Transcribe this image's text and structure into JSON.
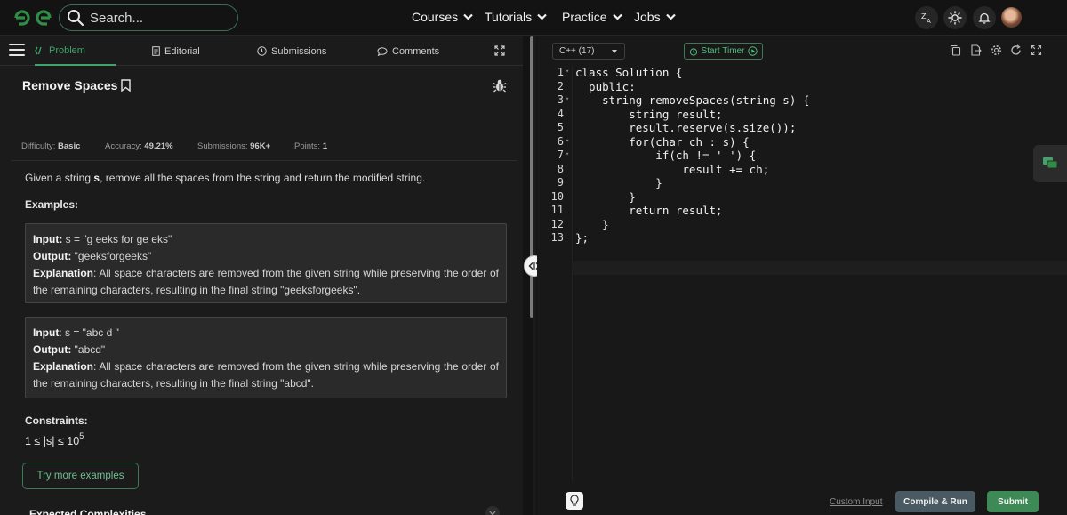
{
  "navbar": {
    "search_placeholder": "Search...",
    "menu": [
      "Courses",
      "Tutorials",
      "Practice",
      "Jobs"
    ],
    "colors": {
      "brand": "#2f8d46",
      "search_border": "#3b6d52"
    }
  },
  "tabs": {
    "problem": "Problem",
    "editorial": "Editorial",
    "submissions": "Submissions",
    "comments": "Comments"
  },
  "problem": {
    "title": "Remove Spaces",
    "difficulty_label": "Difficulty:",
    "difficulty": "Basic",
    "accuracy_label": "Accuracy:",
    "accuracy": "49.21%",
    "submissions_label": "Submissions:",
    "submissions": "96K+",
    "points_label": "Points:",
    "points": "1",
    "desc_before": "Given a string ",
    "desc_var": "s",
    "desc_after": ", remove all the spaces from the string and return the modified string.",
    "examples_heading": "Examples:",
    "examples": [
      {
        "input_label": "Input:",
        "input": " s = \"g  eeks  for ge  eks\"",
        "output_label": "Output:",
        "output": " \"geeksforgeeks\"",
        "explanation_label": "Explanation",
        "explanation": ": All space characters are removed from the given string while preserving the order of the remaining characters, resulting in the final string \"geeksforgeeks\"."
      },
      {
        "input_label": "Input",
        "input": ": s = \"abc  d \"",
        "output_label": "Output:",
        "output": " \"abcd\"",
        "explanation_label": "Explanation",
        "explanation": ":  All space characters are removed from the given string while preserving the order of the remaining characters, resulting in the final string \"abcd\"."
      }
    ],
    "constraints_heading": "Constraints:",
    "constraint_text": "1 ≤ |s| ≤ 10",
    "constraint_exp": "5",
    "try_more": "Try more examples",
    "expected_complexities": "Expected Complexities"
  },
  "editor": {
    "language": "C++ (17)",
    "start_timer": "Start Timer",
    "line_numbers": [
      "1",
      "2",
      "3",
      "4",
      "5",
      "6",
      "7",
      "8",
      "9",
      "10",
      "11",
      "12",
      "13"
    ],
    "code": [
      "class Solution {",
      "  public:",
      "    string removeSpaces(string s) {",
      "        string result;",
      "        result.reserve(s.size());",
      "        for(char ch : s) {",
      "            if(ch != ' ') {",
      "                result += ch;",
      "            }",
      "        }",
      "        return result;",
      "    }",
      "};"
    ],
    "custom_input": "Custom Input",
    "compile_run": "Compile & Run",
    "submit": "Submit"
  }
}
